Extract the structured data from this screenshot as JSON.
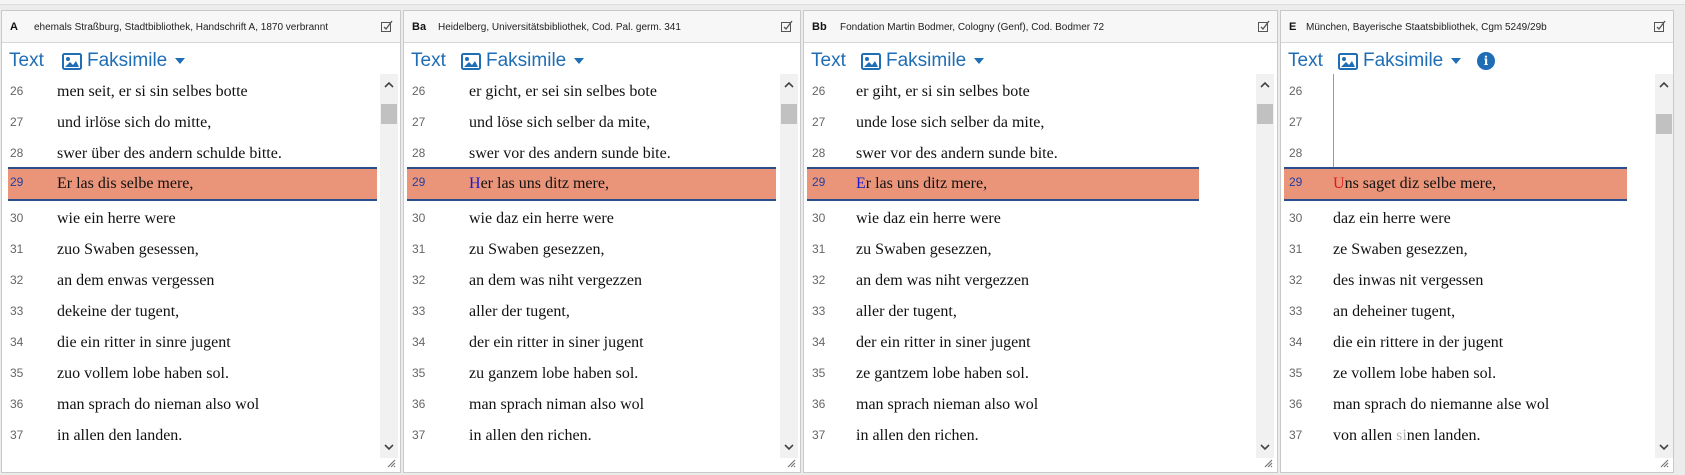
{
  "toolbar": {
    "text_label": "Text",
    "faksimile_label": "Faksimile"
  },
  "colors": {
    "accent": "#1f6db5",
    "highlight": "#ea957a",
    "highlight_border": "#2a4f8e",
    "initial_blue": "#1a1ad0",
    "initial_red": "#e01b1b"
  },
  "icons": {
    "edit": "edit-checkbox-icon",
    "image": "image-icon",
    "dropdown": "caret-down-icon",
    "info": "info-icon",
    "scroll_up": "chevron-up-icon",
    "scroll_down": "chevron-down-icon",
    "resize": "resize-grip-icon"
  },
  "panels": [
    {
      "siglum": "A",
      "source": "ehemals Straßburg, Stadtbibliothek, Handschrift A, 1870 verbrannt",
      "lines": [
        {
          "n": "26",
          "initial": "",
          "text": "men seit, er si sin selbes botte"
        },
        {
          "n": "27",
          "initial": "",
          "text": "und irlöse sich do mitte,"
        },
        {
          "n": "28",
          "initial": "",
          "text": "swer über des andern schulde bitte."
        },
        {
          "n": "29",
          "initial": "",
          "text": "Er las dis selbe mere,"
        },
        {
          "n": "30",
          "initial": "",
          "text": "wie ein herre were"
        },
        {
          "n": "31",
          "initial": "",
          "text": "zuo Swaben gesessen,"
        },
        {
          "n": "32",
          "initial": "",
          "text": "an dem enwas vergessen"
        },
        {
          "n": "33",
          "initial": "",
          "text": "dekeine der tugent,"
        },
        {
          "n": "34",
          "initial": "",
          "text": "die ein ritter in sinre jugent"
        },
        {
          "n": "35",
          "initial": "",
          "text": "zuo vollem lobe haben sol."
        },
        {
          "n": "36",
          "initial": "",
          "text": "man sprach do nieman also wol"
        },
        {
          "n": "37",
          "initial": "",
          "text": "in allen den landen."
        }
      ]
    },
    {
      "siglum": "Ba",
      "source": "Heidelberg, Universitätsbibliothek, Cod. Pal. germ. 341",
      "lines": [
        {
          "n": "26",
          "initial": "",
          "text": "er gicht, er sei sin selbes bote"
        },
        {
          "n": "27",
          "initial": "",
          "text": "und löse sich selber da mite,"
        },
        {
          "n": "28",
          "initial": "",
          "text": "swer vor des andern sunde bite."
        },
        {
          "n": "29",
          "initial": "H",
          "text": "er las uns ditz mere,"
        },
        {
          "n": "30",
          "initial": "",
          "text": "wie daz ein herre were"
        },
        {
          "n": "31",
          "initial": "",
          "text": "zu Swaben gesezzen,"
        },
        {
          "n": "32",
          "initial": "",
          "text": "an dem was niht vergezzen"
        },
        {
          "n": "33",
          "initial": "",
          "text": "aller der tugent,"
        },
        {
          "n": "34",
          "initial": "",
          "text": "der ein ritter in siner jugent"
        },
        {
          "n": "35",
          "initial": "",
          "text": "zu ganzem lobe haben sol."
        },
        {
          "n": "36",
          "initial": "",
          "text": "man sprach niman also wol"
        },
        {
          "n": "37",
          "initial": "",
          "text": "in allen den richen."
        }
      ]
    },
    {
      "siglum": "Bb",
      "source": "Fondation Martin Bodmer, Cologny (Genf), Cod. Bodmer 72",
      "lines": [
        {
          "n": "26",
          "initial": "",
          "text": "er giht, er si sin selbes bote"
        },
        {
          "n": "27",
          "initial": "",
          "text": "unde lose sich selber da mite,"
        },
        {
          "n": "28",
          "initial": "",
          "text": "swer vor des andern sunde bite."
        },
        {
          "n": "29",
          "initial": "E",
          "text": "r las uns ditz mere,"
        },
        {
          "n": "30",
          "initial": "",
          "text": "wie daz ein herre were"
        },
        {
          "n": "31",
          "initial": "",
          "text": "zu Swaben gesezzen,"
        },
        {
          "n": "32",
          "initial": "",
          "text": "an dem was niht vergezzen"
        },
        {
          "n": "33",
          "initial": "",
          "text": "aller der tugent,"
        },
        {
          "n": "34",
          "initial": "",
          "text": "der ein ritter in siner jugent"
        },
        {
          "n": "35",
          "initial": "",
          "text": "ze gantzem lobe haben sol."
        },
        {
          "n": "36",
          "initial": "",
          "text": "man sprach nieman also wol"
        },
        {
          "n": "37",
          "initial": "",
          "text": "in allen den richen."
        }
      ]
    },
    {
      "siglum": "E",
      "source": "München, Bayerische Staatsbibliothek, Cgm 5249/29b",
      "lines": [
        {
          "n": "26",
          "initial": "",
          "text": ""
        },
        {
          "n": "27",
          "initial": "",
          "text": ""
        },
        {
          "n": "28",
          "initial": "",
          "text": ""
        },
        {
          "n": "29",
          "initial": "U",
          "text": "ns saget diz selbe mere,"
        },
        {
          "n": "30",
          "initial": "",
          "text": "daz ein herre were"
        },
        {
          "n": "31",
          "initial": "",
          "text": "ze Swaben gesezzen,"
        },
        {
          "n": "32",
          "initial": "",
          "text": "des inwas nit vergessen"
        },
        {
          "n": "33",
          "initial": "",
          "text": "an deheiner tugent,"
        },
        {
          "n": "34",
          "initial": "",
          "text": "die ein rittere in der jugent"
        },
        {
          "n": "35",
          "initial": "",
          "text": "ze vollem lobe haben sol."
        },
        {
          "n": "36",
          "initial": "",
          "text": "man sprach do niemanne alse wol"
        },
        {
          "n": "37",
          "pre": "von allen ",
          "faded": "si",
          "post": "nen landen."
        }
      ]
    }
  ]
}
